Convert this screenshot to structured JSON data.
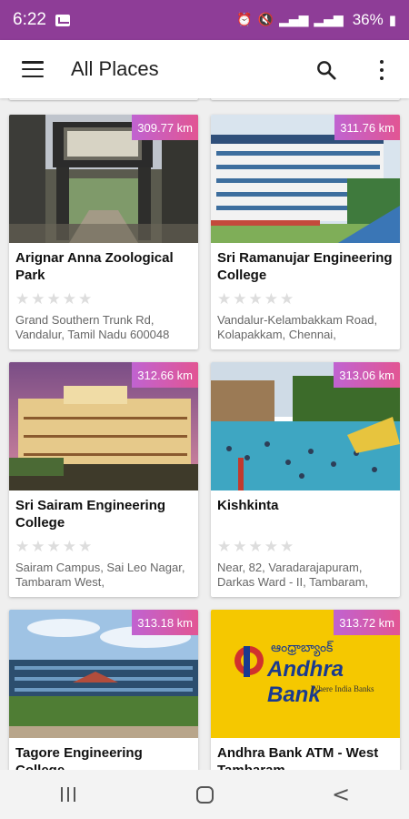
{
  "status_bar": {
    "time": "6:22",
    "network": "Vo) LTE+\nLTE1",
    "battery": "36%"
  },
  "app_bar": {
    "title": "All Places"
  },
  "places": [
    {
      "distance": "309.77 km",
      "name": "Arignar Anna Zoological Park",
      "rating": 0,
      "address": "Grand Southern Trunk Rd, Vandalur, Tamil Nadu 600048"
    },
    {
      "distance": "311.76 km",
      "name": "Sri Ramanujar Engineering College",
      "rating": 0,
      "address": " Vandalur-Kelambakkam Road, Kolapakkam, Chennai,"
    },
    {
      "distance": "312.66 km",
      "name": "Sri Sairam Engineering College",
      "rating": 0,
      "address": "Sairam Campus, Sai Leo Nagar, Tambaram West,"
    },
    {
      "distance": "313.06 km",
      "name": "Kishkinta",
      "rating": 0,
      "address": "Near, 82, Varadarajapuram, Darkas Ward - II, Tambaram,"
    },
    {
      "distance": "313.18 km",
      "name": "Tagore Engineering College",
      "rating": 0,
      "address": ""
    },
    {
      "distance": "313.72 km",
      "name": "Andhra Bank ATM - West Tambaram",
      "rating": 0,
      "address": ""
    }
  ],
  "andhra_logo": {
    "script": "ఆంధ్రాబ్యాంక్",
    "name": "Andhra Bank",
    "tagline": "Where India Banks"
  },
  "colors": {
    "status_bar": "#8e3d97",
    "badge_start": "#c063d1",
    "badge_end": "#e25593"
  }
}
